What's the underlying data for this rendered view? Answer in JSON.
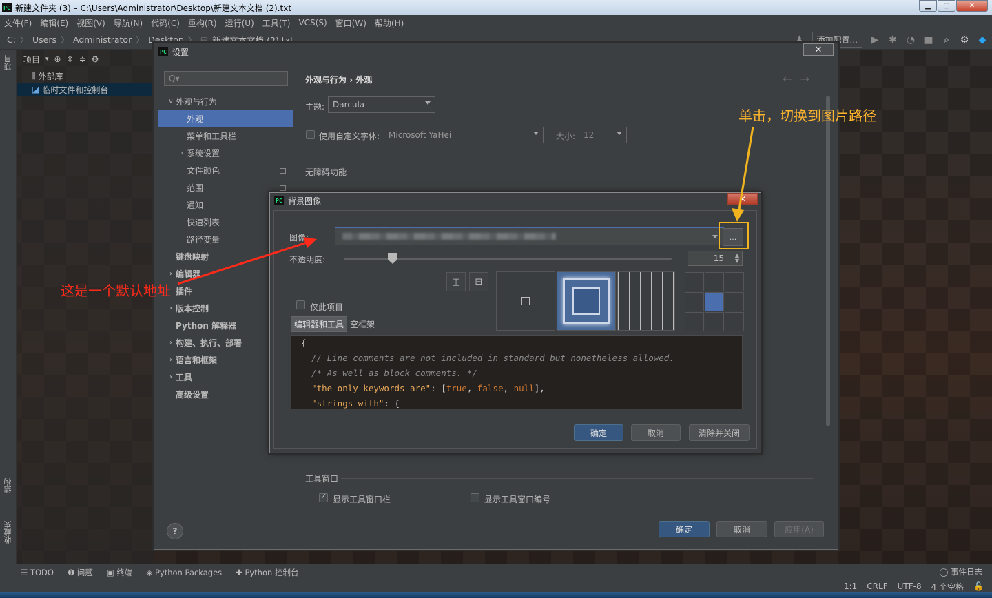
{
  "window": {
    "title": "新建文件夹 (3) – C:\\Users\\Administrator\\Desktop\\新建文本文档 (2).txt",
    "app_icon_text": "PC"
  },
  "menubar": [
    "文件(F)",
    "编辑(E)",
    "视图(V)",
    "导航(N)",
    "代码(C)",
    "重构(R)",
    "运行(U)",
    "工具(T)",
    "VCS(S)",
    "窗口(W)",
    "帮助(H)"
  ],
  "navbar": {
    "crumbs": [
      "C:",
      "Users",
      "Administrator",
      "Desktop",
      "新建文本文档 (2).txt"
    ],
    "add_config": "添加配置..."
  },
  "left_stripe": {
    "project": "项目",
    "structure": "结构",
    "favorites": "收藏夹"
  },
  "project_panel": {
    "header": "项目",
    "items": [
      "外部库",
      "临时文件和控制台"
    ]
  },
  "settings": {
    "title": "设置",
    "close": "✕",
    "search_placeholder": "Q▾",
    "breadcrumb": "外观与行为  ›  外观",
    "tree": [
      {
        "label": "外观与行为",
        "indent": 0,
        "bold": false,
        "arrow": "∨",
        "selected": false
      },
      {
        "label": "外观",
        "indent": 1,
        "bold": false,
        "arrow": "",
        "selected": true
      },
      {
        "label": "菜单和工具栏",
        "indent": 1,
        "bold": false,
        "arrow": "",
        "selected": false
      },
      {
        "label": "系统设置",
        "indent": 1,
        "bold": false,
        "arrow": "›",
        "selected": false
      },
      {
        "label": "文件颜色",
        "indent": 1,
        "bold": false,
        "arrow": "",
        "selected": false,
        "mark": true
      },
      {
        "label": "范围",
        "indent": 1,
        "bold": false,
        "arrow": "",
        "selected": false,
        "mark": true
      },
      {
        "label": "通知",
        "indent": 1,
        "bold": false,
        "arrow": "",
        "selected": false
      },
      {
        "label": "快速列表",
        "indent": 1,
        "bold": false,
        "arrow": "",
        "selected": false
      },
      {
        "label": "路径变量",
        "indent": 1,
        "bold": false,
        "arrow": "",
        "selected": false
      },
      {
        "label": "键盘映射",
        "indent": 0,
        "bold": true,
        "arrow": "",
        "selected": false
      },
      {
        "label": "编辑器",
        "indent": 0,
        "bold": true,
        "arrow": "›",
        "selected": false
      },
      {
        "label": "插件",
        "indent": 0,
        "bold": true,
        "arrow": "",
        "selected": false
      },
      {
        "label": "版本控制",
        "indent": 0,
        "bold": true,
        "arrow": "›",
        "selected": false
      },
      {
        "label": "Python 解释器",
        "indent": 0,
        "bold": true,
        "arrow": "",
        "selected": false
      },
      {
        "label": "构建、执行、部署",
        "indent": 0,
        "bold": true,
        "arrow": "›",
        "selected": false
      },
      {
        "label": "语言和框架",
        "indent": 0,
        "bold": true,
        "arrow": "›",
        "selected": false
      },
      {
        "label": "工具",
        "indent": 0,
        "bold": true,
        "arrow": "›",
        "selected": false
      },
      {
        "label": "高级设置",
        "indent": 0,
        "bold": true,
        "arrow": "",
        "selected": false
      }
    ],
    "theme_label": "主题:",
    "theme_value": "Darcula",
    "custom_font_label": "使用自定义字体:",
    "custom_font_value": "Microsoft YaHei",
    "size_label": "大小:",
    "size_value": "12",
    "accessibility_header": "无障碍功能",
    "tool_window_header": "工具窗口",
    "show_tool_window_bars": "显示工具窗口栏",
    "show_tool_window_numbers": "显示工具窗口编号",
    "ok": "确定",
    "cancel": "取消",
    "apply": "应用(A)",
    "help": "?"
  },
  "bg_dialog": {
    "title": "背景图像",
    "close": "✕",
    "image_label": "图像:",
    "browse": "...",
    "opacity_label": "不透明度:",
    "opacity_value": "15",
    "opacity_fraction": 0.15,
    "this_project_only": "仅此项目",
    "tab_editor_tools": "编辑器和工具",
    "tab_empty_frame": "空框架",
    "code_lines": [
      {
        "parts": [
          {
            "t": "{",
            "c": "pl"
          }
        ]
      },
      {
        "parts": [
          {
            "t": "  // Line comments are not included in standard but nonetheless allowed.",
            "c": "cm"
          }
        ]
      },
      {
        "parts": [
          {
            "t": "  /* As well as block comments. */",
            "c": "cm"
          }
        ]
      },
      {
        "parts": [
          {
            "t": "  \"the only keywords are\"",
            "c": "str"
          },
          {
            "t": ": [",
            "c": "pl"
          },
          {
            "t": "true",
            "c": "kw"
          },
          {
            "t": ", ",
            "c": "pl"
          },
          {
            "t": "false",
            "c": "kw"
          },
          {
            "t": ", ",
            "c": "pl"
          },
          {
            "t": "null",
            "c": "kw"
          },
          {
            "t": "],",
            "c": "pl"
          }
        ]
      },
      {
        "parts": [
          {
            "t": "  \"strings with\"",
            "c": "str"
          },
          {
            "t": ": {",
            "c": "pl"
          }
        ]
      }
    ],
    "ok": "确定",
    "cancel": "取消",
    "clear_close": "清除并关闭"
  },
  "bottom_tools": [
    "TODO",
    "问题",
    "终端",
    "Python Packages",
    "Python 控制台"
  ],
  "event_log": "事件日志",
  "status": [
    "1:1",
    "CRLF",
    "UTF-8",
    "4 个空格"
  ],
  "annotations": {
    "default_address": "这是一个默认地址",
    "click_switch": "单击，切换到图片路径"
  },
  "colors": {
    "accent": "#4b6eaf",
    "annotation_red": "#ff2a1a",
    "annotation_yellow": "#f2b41e"
  }
}
